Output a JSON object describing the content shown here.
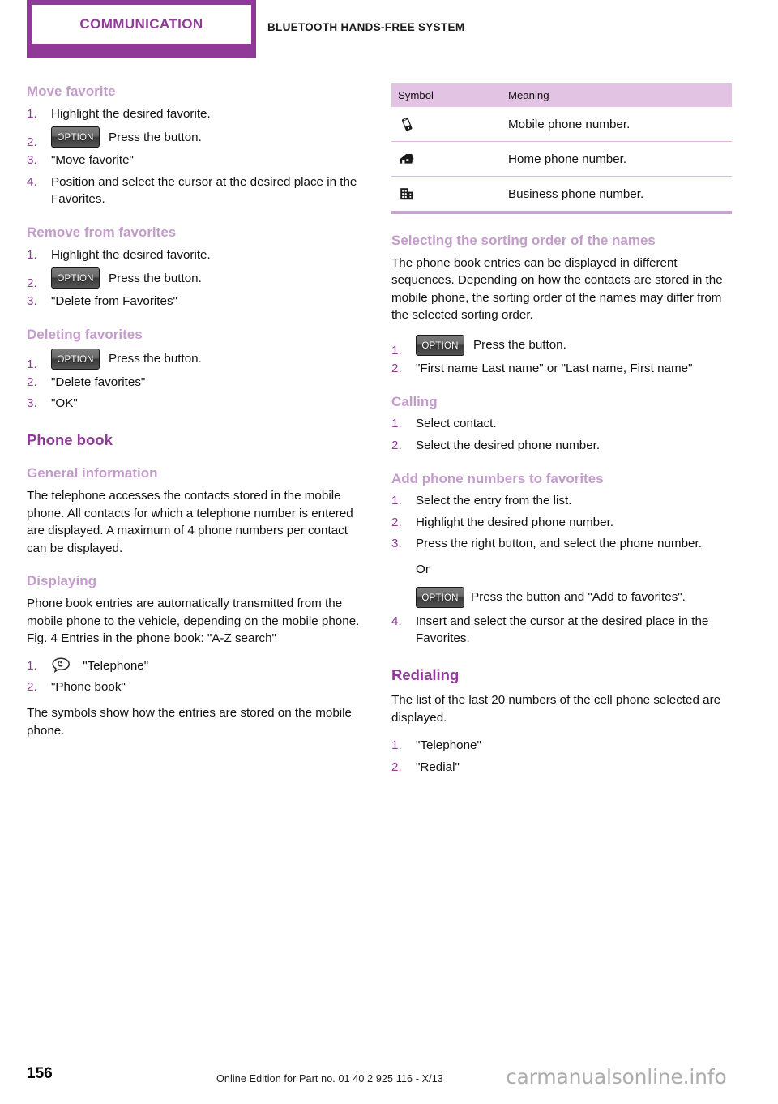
{
  "header": {
    "tab_label": "COMMUNICATION",
    "subtitle": "BLUETOOTH HANDS-FREE SYSTEM",
    "accent_color": "#8e3a96"
  },
  "left_column": {
    "move_favorite": {
      "heading": "Move favorite",
      "steps": [
        {
          "num": "1.",
          "text": "Highlight the desired favorite."
        },
        {
          "num": "2.",
          "button": "OPTION",
          "text": "Press the button."
        },
        {
          "num": "3.",
          "text": "\"Move favorite\""
        },
        {
          "num": "4.",
          "text": "Position and select the cursor at the desired place in the Favorites."
        }
      ]
    },
    "remove_from_favorites": {
      "heading": "Remove from favorites",
      "steps": [
        {
          "num": "1.",
          "text": "Highlight the desired favorite."
        },
        {
          "num": "2.",
          "button": "OPTION",
          "text": "Press the button."
        },
        {
          "num": "3.",
          "text": "\"Delete from Favorites\""
        }
      ]
    },
    "deleting_favorites": {
      "heading": "Deleting favorites",
      "steps": [
        {
          "num": "1.",
          "button": "OPTION",
          "text": "Press the button."
        },
        {
          "num": "2.",
          "text": "\"Delete favorites\""
        },
        {
          "num": "3.",
          "text": "\"OK\""
        }
      ]
    },
    "phone_book": {
      "heading": "Phone book",
      "general_information": {
        "heading": "General information",
        "paragraph": "The telephone accesses the contacts stored in the mobile phone. All contacts for which a telephone number is entered are displayed. A maximum of 4 phone numbers per contact can be displayed."
      },
      "displaying": {
        "heading": "Displaying",
        "paragraph": "Phone book entries are automatically transmitted from the mobile phone to the vehicle, depending on the mobile phone. Fig. 4 Entries in the phone book: \"A-Z search\"",
        "steps": [
          {
            "num": "1.",
            "icon": "telephone-icon",
            "text": "\"Telephone\""
          },
          {
            "num": "2.",
            "text": "\"Phone book\""
          }
        ],
        "closing_paragraph": "The symbols show how the entries are stored on the mobile phone."
      }
    }
  },
  "right_column": {
    "symbol_table": {
      "columns": [
        "Symbol",
        "Meaning"
      ],
      "rows": [
        {
          "icon": "mobile-phone-icon",
          "meaning": "Mobile phone number."
        },
        {
          "icon": "house-icon",
          "meaning": "Home phone number."
        },
        {
          "icon": "office-building-icon",
          "meaning": "Business phone number."
        }
      ]
    },
    "sorting_order": {
      "heading": "Selecting the sorting order of the names",
      "paragraph": "The phone book entries can be displayed in different sequences. Depending on how the contacts are stored in the mobile phone, the sorting order of the names may differ from the selected sorting order.",
      "steps": [
        {
          "num": "1.",
          "button": "OPTION",
          "text": "Press the button."
        },
        {
          "num": "2.",
          "text": "\"First name Last name\" or \"Last name, First name\""
        }
      ]
    },
    "calling": {
      "heading": "Calling",
      "steps": [
        {
          "num": "1.",
          "text": "Select contact."
        },
        {
          "num": "2.",
          "text": "Select the desired phone number."
        }
      ]
    },
    "add_phone_numbers": {
      "heading": "Add phone numbers to favorites",
      "steps": [
        {
          "num": "1.",
          "text": "Select the entry from the list."
        },
        {
          "num": "2.",
          "text": "Highlight the desired phone number."
        },
        {
          "num": "3.",
          "text": "Press the right button, and select the phone number."
        }
      ],
      "or_label": "Or",
      "or_button": "OPTION",
      "or_text": "Press the button and \"Add to favorites\".",
      "step4": {
        "num": "4.",
        "text": "Insert and select the cursor at the desired place in the Favorites."
      }
    },
    "redialing": {
      "heading": "Redialing",
      "paragraph": "The list of the last 20 numbers of the cell phone selected are displayed.",
      "steps": [
        {
          "num": "1.",
          "text": "\"Telephone\""
        },
        {
          "num": "2.",
          "text": "\"Redial\""
        }
      ]
    }
  },
  "footer": {
    "page_number": "156",
    "note": "Online Edition for Part no. 01 40 2 925 116 - X/13",
    "watermark": "carmanualsonline.info"
  }
}
